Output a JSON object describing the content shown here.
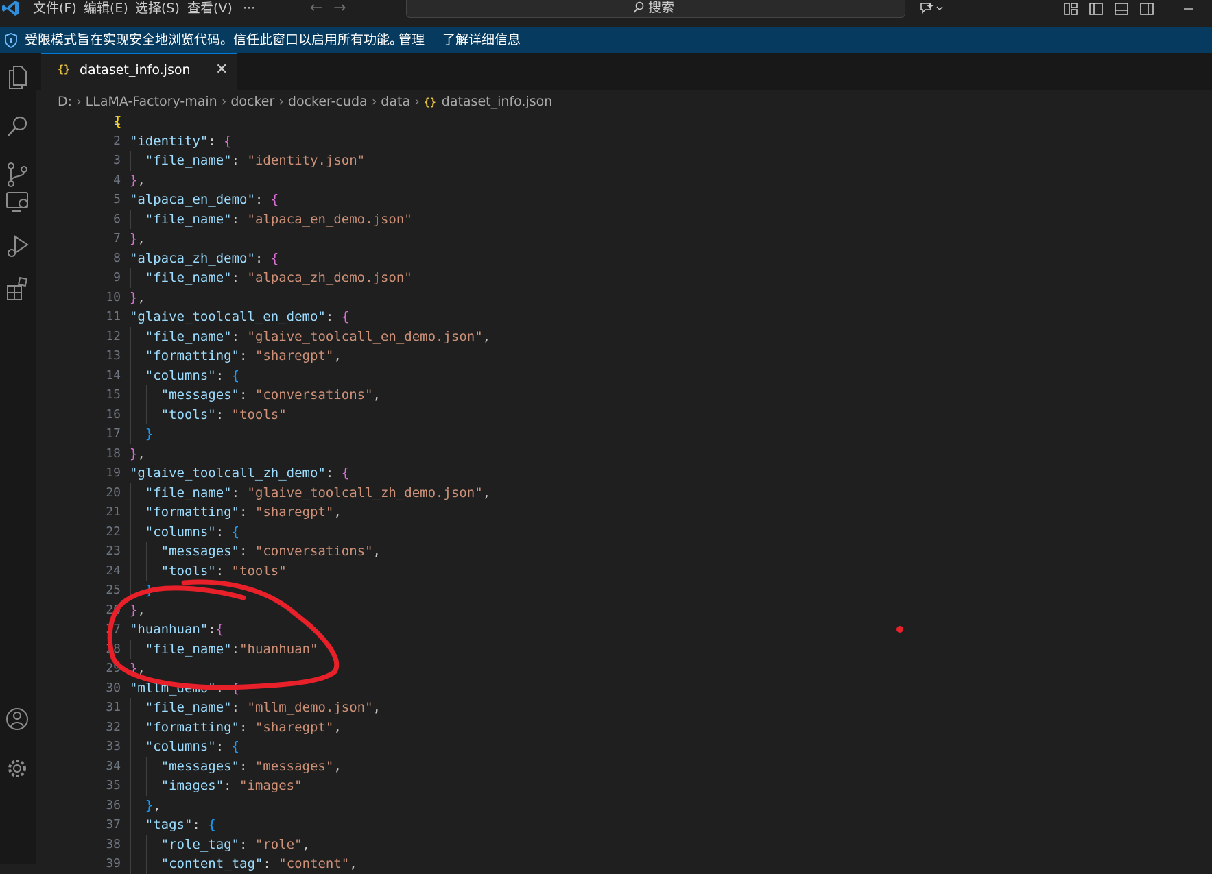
{
  "menu": {
    "file": "文件(F)",
    "edit": "编辑(E)",
    "selection": "选择(S)",
    "view": "查看(V)",
    "more": "···"
  },
  "search": {
    "label": "搜索"
  },
  "banner": {
    "text": "受限模式旨在实现安全地浏览代码。信任此窗口以启用所有功能。",
    "manage": "管理",
    "learn_more": "了解详细信息"
  },
  "tab": {
    "label": "dataset_info.json",
    "icon": "{}"
  },
  "breadcrumb": [
    "D:",
    "LLaMA-Factory-main",
    "docker",
    "docker-cuda",
    "data",
    "dataset_info.json"
  ],
  "editor": {
    "active_line": 1,
    "lines": [
      "{",
      "  \"identity\": {",
      "    \"file_name\": \"identity.json\"",
      "  },",
      "  \"alpaca_en_demo\": {",
      "    \"file_name\": \"alpaca_en_demo.json\"",
      "  },",
      "  \"alpaca_zh_demo\": {",
      "    \"file_name\": \"alpaca_zh_demo.json\"",
      "  },",
      "  \"glaive_toolcall_en_demo\": {",
      "    \"file_name\": \"glaive_toolcall_en_demo.json\",",
      "    \"formatting\": \"sharegpt\",",
      "    \"columns\": {",
      "      \"messages\": \"conversations\",",
      "      \"tools\": \"tools\"",
      "    }",
      "  },",
      "  \"glaive_toolcall_zh_demo\": {",
      "    \"file_name\": \"glaive_toolcall_zh_demo.json\",",
      "    \"formatting\": \"sharegpt\",",
      "    \"columns\": {",
      "      \"messages\": \"conversations\",",
      "      \"tools\": \"tools\"",
      "    }",
      "  },",
      "  \"huanhuan\":{",
      "    \"file_name\":\"huanhuan\"",
      "  },",
      "  \"mllm_demo\": {",
      "    \"file_name\": \"mllm_demo.json\",",
      "    \"formatting\": \"sharegpt\",",
      "    \"columns\": {",
      "      \"messages\": \"messages\",",
      "      \"images\": \"images\"",
      "    },",
      "    \"tags\": {",
      "      \"role_tag\": \"role\",",
      "      \"content_tag\": \"content\","
    ]
  },
  "colors": {
    "accent": "#0078d4",
    "banner": "#063b5f",
    "annotation": "#e8202a"
  },
  "icons": {
    "activity_bar": [
      "explorer-icon",
      "search-icon",
      "source-control-icon",
      "remote-explorer-icon",
      "run-debug-icon",
      "extensions-icon",
      "account-icon",
      "settings-gear-icon"
    ]
  }
}
